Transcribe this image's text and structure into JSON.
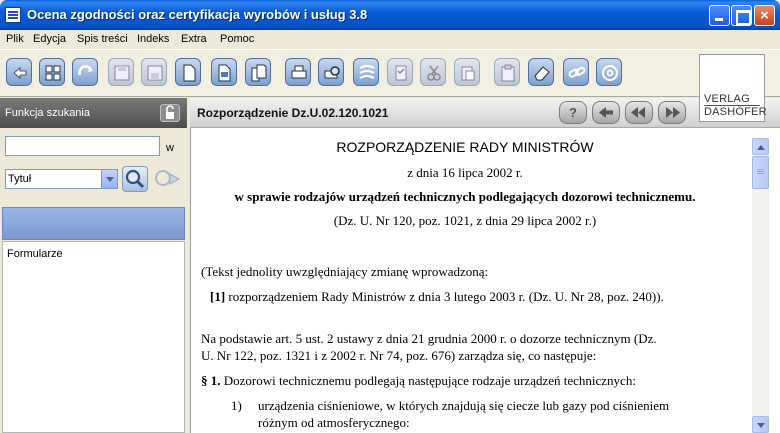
{
  "window": {
    "title": "Ocena zgodności oraz certyfikacja wyrobów i usług 3.8",
    "close_glyph": "×"
  },
  "menu": [
    "Plik",
    "Edycja",
    "Spis treści",
    "Indeks",
    "Extra",
    "Pomoc"
  ],
  "toolbar": {
    "icons": [
      "back-icon",
      "browse-icon",
      "refresh-icon",
      "save-icon",
      "save-as-icon",
      "new-document-icon",
      "document-view-icon",
      "document-copy-icon",
      "print-icon",
      "print-preview-icon",
      "reader-icon",
      "checklist-icon",
      "cut-icon",
      "paste-icon",
      "clipboard-icon",
      "eraser-icon",
      "link-icon",
      "email-icon"
    ],
    "disabled": [
      false,
      false,
      false,
      true,
      true,
      false,
      false,
      false,
      false,
      false,
      false,
      true,
      true,
      true,
      true,
      false,
      false,
      false
    ],
    "logo_line1": "VERLAG",
    "logo_line2": "DASHÖFER"
  },
  "left_panel": {
    "title": "Funkcja szukania",
    "search_value": "",
    "w_label": "w",
    "field_selected": "Tytuł",
    "results": [
      "Formularze"
    ]
  },
  "document": {
    "title": "Rozporządzenie Dz.U.02.120.1021",
    "nav_help": "?",
    "heading": "ROZPORZĄDZENIE RADY MINISTRÓW",
    "date_line": "z dnia 16 lipca 2002 r.",
    "subject": "w sprawie rodzajów urządzeń technicznych podlegających dozorowi technicznemu.",
    "source": "(Dz. U. Nr 120, poz. 1021, z dnia 29 lipca 2002 r.)",
    "consolidated_intro": "(Tekst jednolity uwzględniający zmianę wprowadzoną:",
    "amendment_number": "[1]",
    "amendment_text": "rozporządzeniem Rady Ministrów z dnia 3 lutego 2003 r. (Dz. U. Nr 28, poz. 240)).",
    "basis_line1": "Na podstawie art. 5 ust. 2 ustawy z dnia 21 grudnia 2000 r. o dozorze technicznym (Dz.",
    "basis_line2": "U. Nr 122, poz. 1321 i z 2002 r. Nr 74, poz. 676) zarządza się, co następuje:",
    "section_marker": "§ 1.",
    "section_text": "Dozorowi technicznemu podlegają następujące rodzaje urządzeń technicznych:",
    "item1_number": "1)",
    "item1_line1": "urządzenia ciśnieniowe, w których znajdują się ciecze lub gazy pod ciśnieniem",
    "item1_line2": "różnym od atmosferycznego:"
  }
}
